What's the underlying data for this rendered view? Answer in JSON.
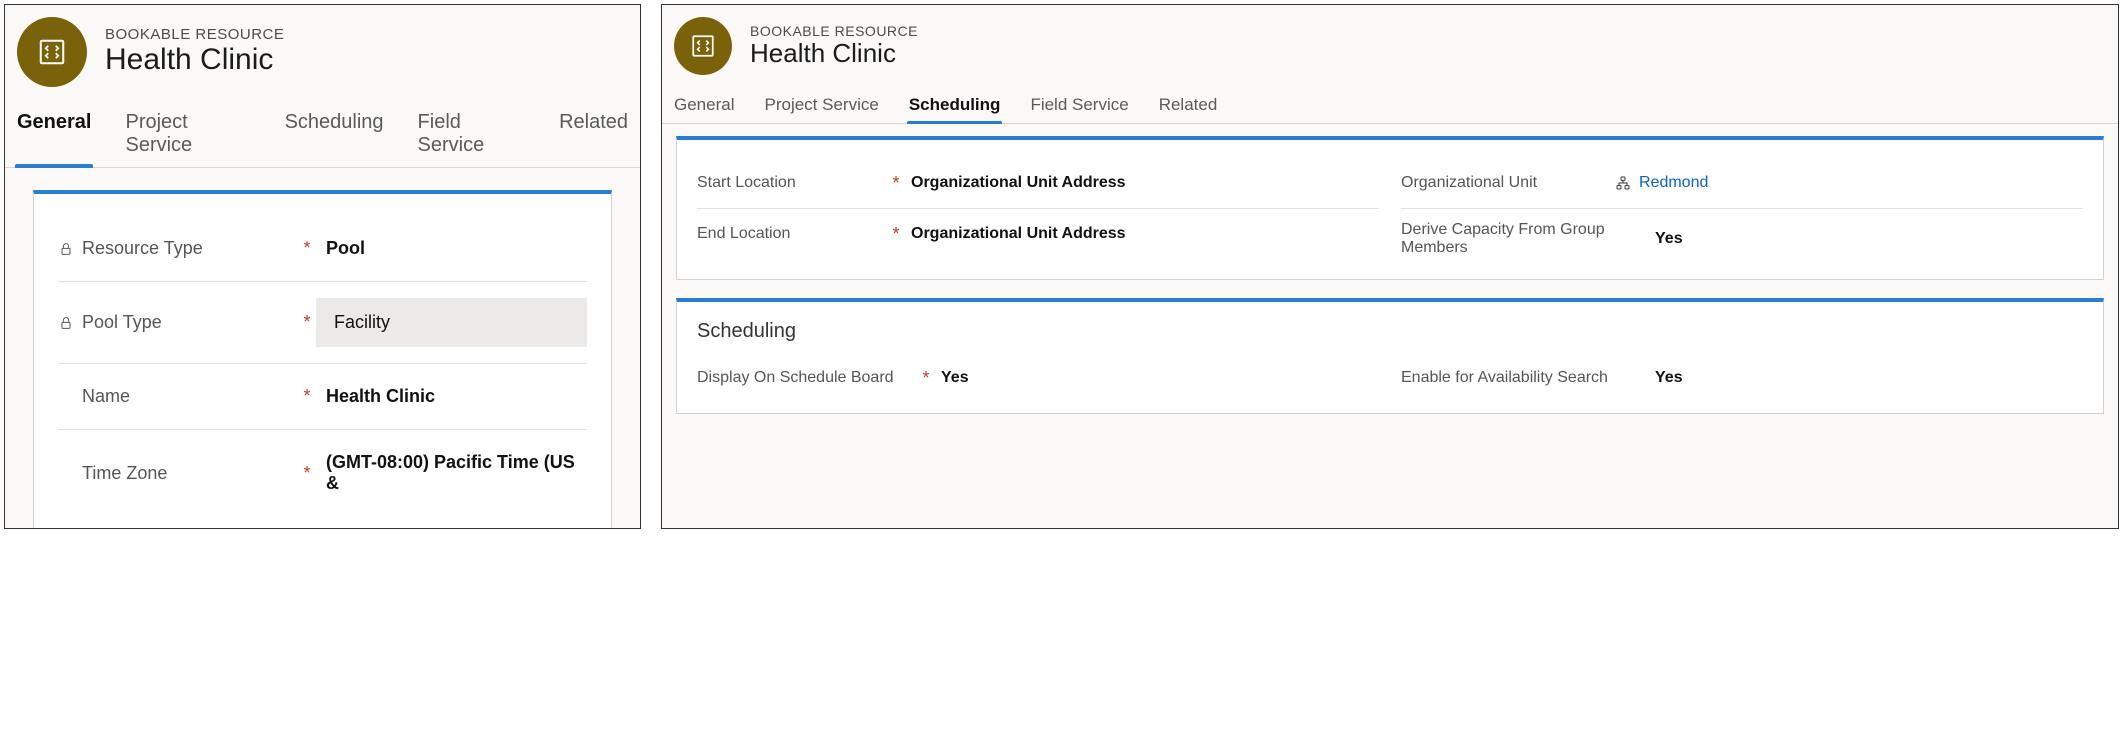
{
  "left": {
    "subtitle": "BOOKABLE RESOURCE",
    "title": "Health Clinic",
    "tabs": [
      "General",
      "Project Service",
      "Scheduling",
      "Field Service",
      "Related"
    ],
    "active_tab": "General",
    "fields": {
      "resource_type": {
        "label": "Resource Type",
        "required": true,
        "locked": true,
        "value": "Pool"
      },
      "pool_type": {
        "label": "Pool Type",
        "required": true,
        "locked": true,
        "value": "Facility"
      },
      "name": {
        "label": "Name",
        "required": true,
        "locked": false,
        "value": "Health Clinic"
      },
      "time_zone": {
        "label": "Time Zone",
        "required": true,
        "locked": false,
        "value": "(GMT-08:00) Pacific Time (US &"
      }
    }
  },
  "right": {
    "subtitle": "BOOKABLE RESOURCE",
    "title": "Health Clinic",
    "tabs": [
      "General",
      "Project Service",
      "Scheduling",
      "Field Service",
      "Related"
    ],
    "active_tab": "Scheduling",
    "section1": {
      "start_location": {
        "label": "Start Location",
        "required": true,
        "value": "Organizational Unit Address"
      },
      "end_location": {
        "label": "End Location",
        "required": true,
        "value": "Organizational Unit Address"
      },
      "org_unit": {
        "label": "Organizational Unit",
        "value": "Redmond"
      },
      "derive_capacity": {
        "label": "Derive Capacity From Group Members",
        "value": "Yes"
      }
    },
    "section2": {
      "title": "Scheduling",
      "display_on_board": {
        "label": "Display On Schedule Board",
        "required": true,
        "value": "Yes"
      },
      "enable_avail": {
        "label": "Enable for Availability Search",
        "value": "Yes"
      }
    }
  }
}
